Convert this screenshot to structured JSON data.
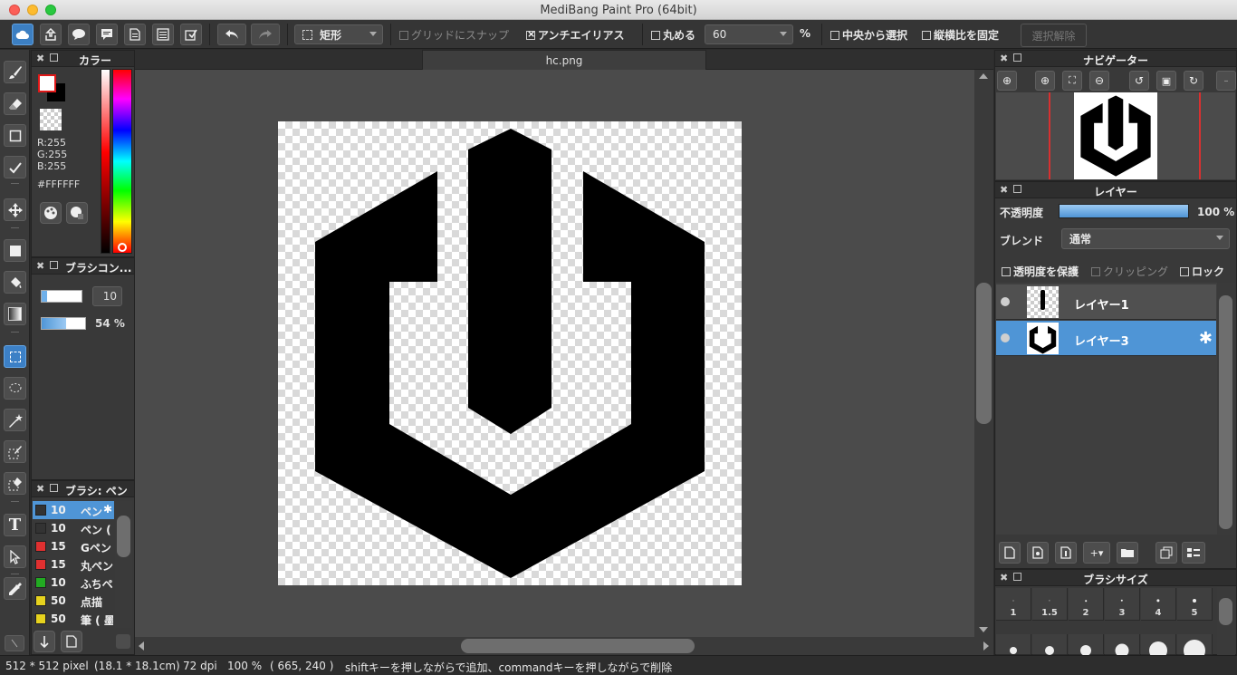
{
  "window": {
    "title": "MediBang Paint Pro (64bit)"
  },
  "toolbar": {
    "shape_select": "矩形",
    "snap_grid_label": "グリッドにスナップ",
    "antialias_label": "アンチエイリアス",
    "round_label": "丸める",
    "round_value": "60",
    "percent_sign": "%",
    "select_from_center_label": "中央から選択",
    "fix_aspect_label": "縦横比を固定",
    "deselect_label": "選択解除",
    "antialias_checked": true,
    "snap_grid_checked": false,
    "round_checked": false,
    "center_checked": false,
    "aspect_checked": false
  },
  "document": {
    "tab_name": "hc.png"
  },
  "color_panel": {
    "title": "カラー",
    "r": "R:255",
    "g": "G:255",
    "b": "B:255",
    "hex": "#FFFFFF",
    "foreground": "#FFFFFF",
    "background": "#000000"
  },
  "brush_control": {
    "title": "ブラシコン...",
    "size_value": "10",
    "opacity_value": "54 %"
  },
  "brush_list": {
    "title": "ブラシ: ペン",
    "items": [
      {
        "size": "10",
        "name": "ペン",
        "color": "#333333",
        "selected": true
      },
      {
        "size": "10",
        "name": "ペン (",
        "color": "#333333",
        "selected": false
      },
      {
        "size": "15",
        "name": "Gペン",
        "color": "#e03030",
        "selected": false
      },
      {
        "size": "15",
        "name": "丸ペン",
        "color": "#e03030",
        "selected": false
      },
      {
        "size": "10",
        "name": "ふちペ",
        "color": "#22aa22",
        "selected": false
      },
      {
        "size": "50",
        "name": "点描",
        "color": "#e6d21e",
        "selected": false
      },
      {
        "size": "50",
        "name": "筆 ( 墨",
        "color": "#e6d21e",
        "selected": false
      }
    ]
  },
  "navigator": {
    "title": "ナビゲーター"
  },
  "layers": {
    "title": "レイヤー",
    "opacity_label": "不透明度",
    "opacity_value": "100 %",
    "opacity_fraction": 1.0,
    "blend_label": "ブレンド",
    "blend_value": "通常",
    "protect_alpha_label": "透明度を保護",
    "clipping_label": "クリッピング",
    "lock_label": "ロック",
    "items": [
      {
        "name": "レイヤー1",
        "selected": false
      },
      {
        "name": "レイヤー3",
        "selected": true
      }
    ]
  },
  "brush_size": {
    "title": "ブラシサイズ",
    "sizes": [
      "1",
      "1.5",
      "2",
      "3",
      "4",
      "5"
    ]
  },
  "status": {
    "dimensions": "512 * 512 pixel",
    "physical": "(18.1 * 18.1cm)",
    "dpi": "72 dpi",
    "zoom": "100 %",
    "cursor": "( 665, 240 )",
    "hint": "shiftキーを押しながらで追加、commandキーを押しながらで削除"
  },
  "colors": {
    "accent": "#4f95d6",
    "panel": "#393939",
    "canvas_bg": "#4b4b4b"
  }
}
